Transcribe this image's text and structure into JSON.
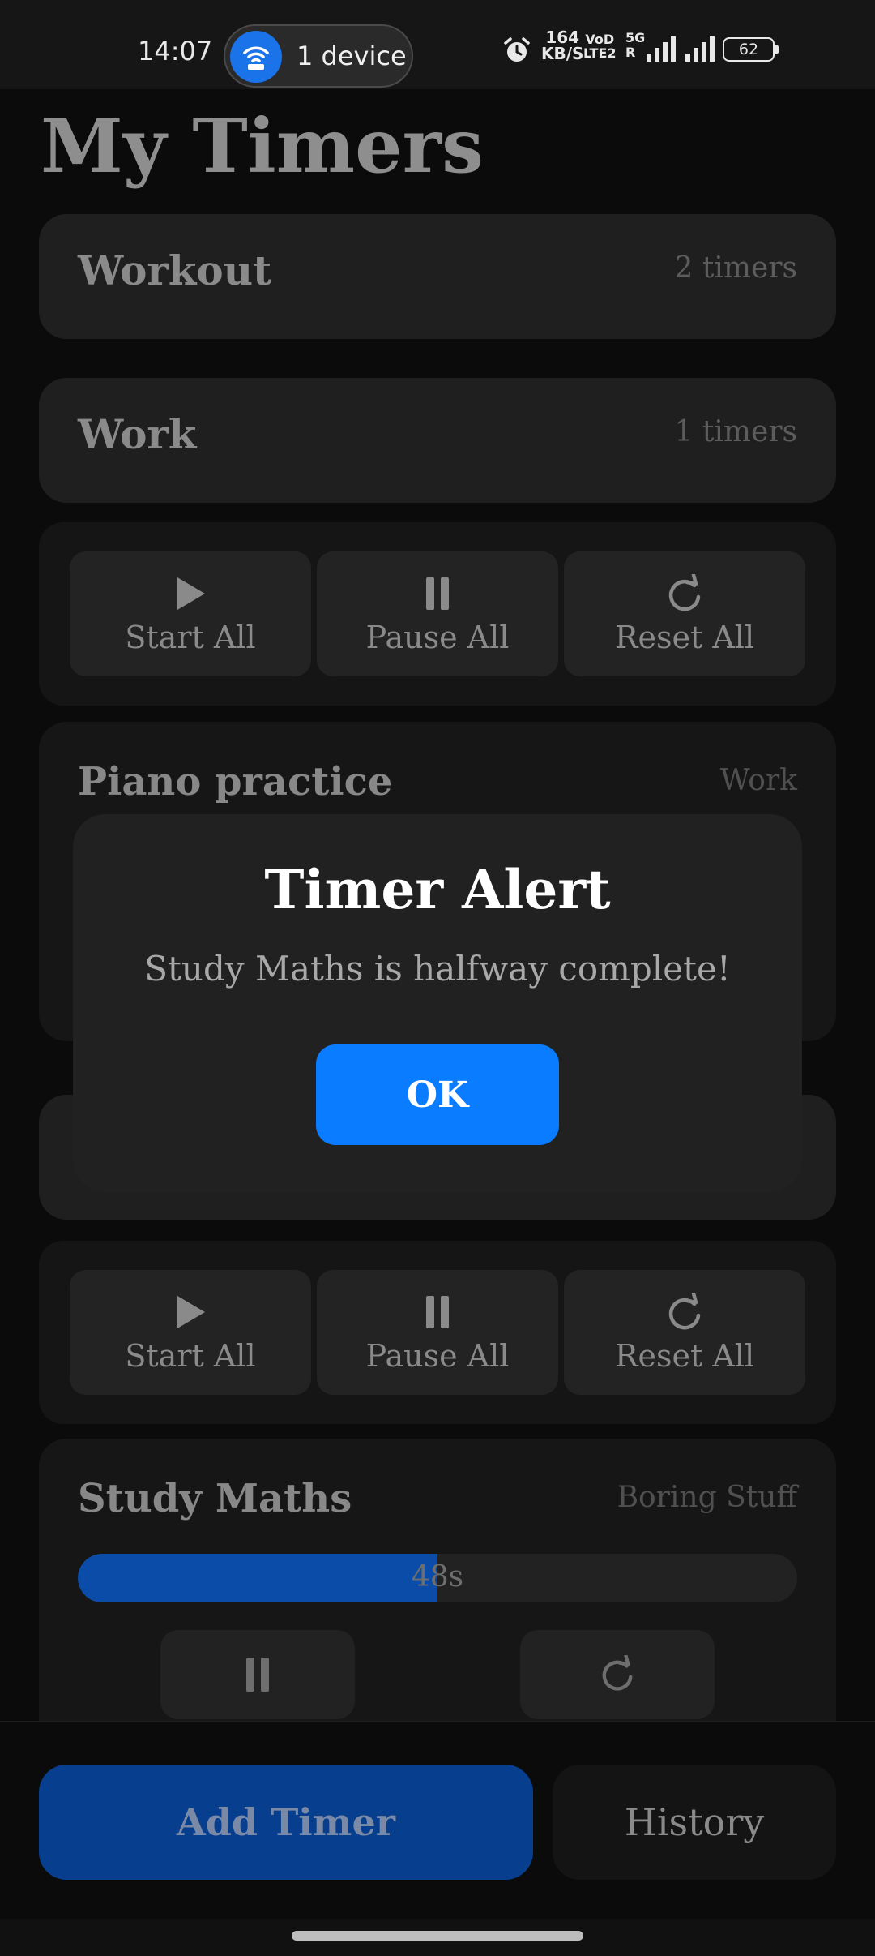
{
  "status_bar": {
    "time": "14:07",
    "hotspot_label": "1 device",
    "speed_value": "164",
    "speed_unit": "KB/S",
    "volte_top": "VoD",
    "volte_bottom": "LTE2",
    "network_top": "5G",
    "network_bottom": "R",
    "battery": "62"
  },
  "page": {
    "title": "My Timers"
  },
  "groups": [
    {
      "name": "Workout",
      "count": "2 timers"
    },
    {
      "name": "Work",
      "count": "1 timers"
    }
  ],
  "controls": {
    "start_all": "Start All",
    "pause_all": "Pause All",
    "reset_all": "Reset All"
  },
  "timers": {
    "piano": {
      "name": "Piano practice",
      "group": "Work"
    },
    "study": {
      "name": "Study Maths",
      "group": "Boring Stuff",
      "time_left": "48s",
      "progress_percent": 50
    }
  },
  "modal": {
    "title": "Timer Alert",
    "message": "Study Maths is halfway complete!",
    "ok_label": "OK"
  },
  "bottom": {
    "add_label": "Add Timer",
    "history_label": "History"
  },
  "colors": {
    "accent": "#0a7cff",
    "progress": "#0a4ca8",
    "add_button": "#073f8e"
  }
}
